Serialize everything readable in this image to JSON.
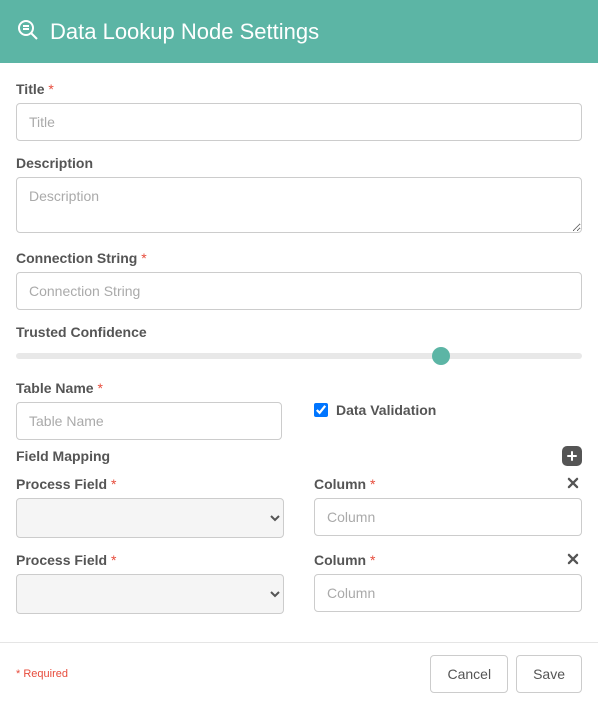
{
  "header": {
    "title": "Data Lookup Node Settings"
  },
  "fields": {
    "title": {
      "label": "Title",
      "required": "*",
      "placeholder": "Title",
      "value": ""
    },
    "description": {
      "label": "Description",
      "placeholder": "Description",
      "value": ""
    },
    "connection_string": {
      "label": "Connection String",
      "required": "*",
      "placeholder": "Connection String",
      "value": ""
    },
    "trusted_confidence": {
      "label": "Trusted Confidence",
      "value_percent": 75
    },
    "table_name": {
      "label": "Table Name",
      "required": "*",
      "placeholder": "Table Name",
      "value": ""
    },
    "data_validation": {
      "label": "Data Validation",
      "checked": true
    }
  },
  "field_mapping": {
    "title": "Field Mapping",
    "process_field_label": "Process Field",
    "process_field_required": "*",
    "column_label": "Column",
    "column_required": "*",
    "column_placeholder": "Column",
    "rows": [
      {
        "process_field": "",
        "column": ""
      },
      {
        "process_field": "",
        "column": ""
      }
    ]
  },
  "footer": {
    "required_note": "* Required",
    "cancel": "Cancel",
    "save": "Save"
  },
  "colors": {
    "accent": "#5cb5a5",
    "required": "#e74c3c"
  }
}
